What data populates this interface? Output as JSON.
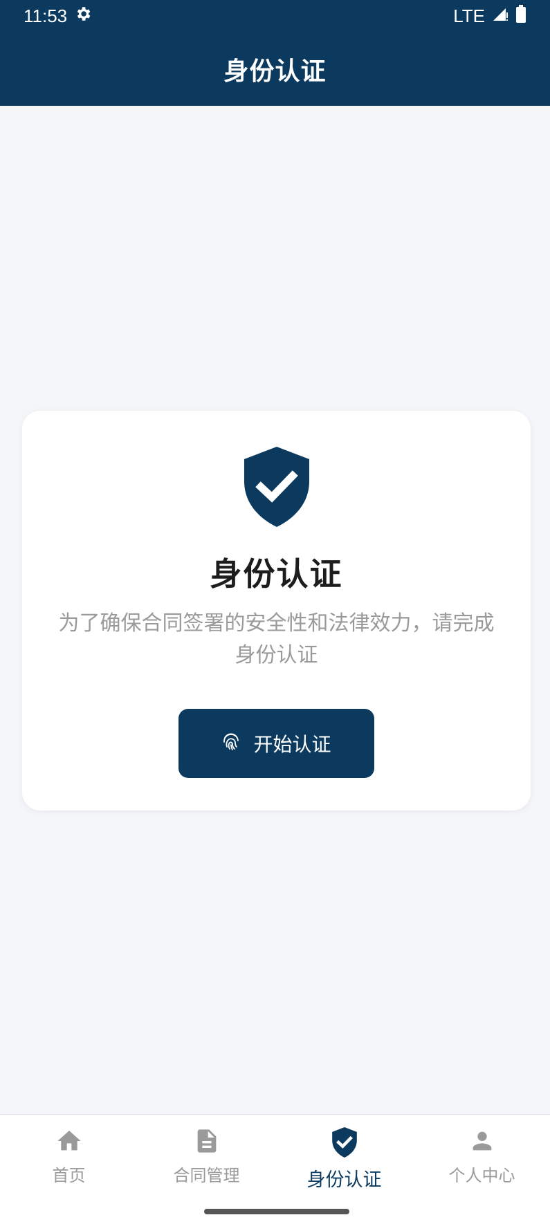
{
  "status_bar": {
    "time": "11:53",
    "network": "LTE",
    "icons": [
      "settings-gear-icon",
      "signal-icon",
      "battery-icon"
    ]
  },
  "app_bar": {
    "title": "身份认证"
  },
  "card": {
    "icon": "shield-check-icon",
    "title": "身份认证",
    "description": "为了确保合同签署的安全性和法律效力，请完成身份认证",
    "button": {
      "icon": "fingerprint-icon",
      "label": "开始认证"
    }
  },
  "bottom_nav": {
    "items": [
      {
        "icon": "home-icon",
        "label": "首页",
        "active": false
      },
      {
        "icon": "document-icon",
        "label": "合同管理",
        "active": false
      },
      {
        "icon": "shield-check-icon",
        "label": "身份认证",
        "active": true
      },
      {
        "icon": "person-icon",
        "label": "个人中心",
        "active": false
      }
    ]
  },
  "colors": {
    "primary": "#0c3a5f",
    "background": "#f4f6fa",
    "inactive": "#9a9a9a",
    "card": "#ffffff"
  }
}
